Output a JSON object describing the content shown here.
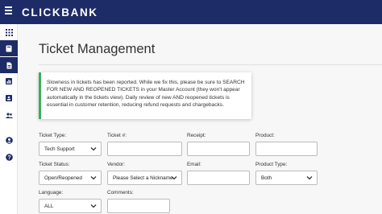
{
  "header": {
    "logo": "CLICKBANK",
    "menu_icon": "hamburger-menu-icon"
  },
  "sidebar": {
    "items": [
      {
        "icon": "grid-icon",
        "active": false
      },
      {
        "icon": "book-icon",
        "active": true
      },
      {
        "icon": "document-icon",
        "active": true
      },
      {
        "icon": "bar-chart-icon",
        "active": false
      },
      {
        "icon": "id-card-icon",
        "active": false
      },
      {
        "icon": "users-icon",
        "active": false
      },
      {
        "icon": "account-circle-icon",
        "active": false
      },
      {
        "icon": "help-icon",
        "active": false
      }
    ]
  },
  "page": {
    "title": "Ticket Management"
  },
  "alert": {
    "message": "Slowness in tickets has been reported. While we fix this, please be sure to SEARCH FOR NEW AND REOPENED TICKETS in your Master Account (they won't appear automatically in the tickets view). Daily review of new AND reopened tickets is essential in customer retention, reducing refund requests and chargebacks.",
    "accent_color": "#3cae5b"
  },
  "form": {
    "ticket_type": {
      "label": "Ticket Type:",
      "value": "Tech Support"
    },
    "ticket_number": {
      "label": "Ticket #:",
      "value": ""
    },
    "receipt": {
      "label": "Receipt:",
      "value": ""
    },
    "product": {
      "label": "Product:",
      "value": ""
    },
    "ticket_status": {
      "label": "Ticket Status:",
      "value": "Open/Reopened"
    },
    "vendor": {
      "label": "Vendor:",
      "value": "Please Select a Nickname"
    },
    "email": {
      "label": "Email:",
      "value": ""
    },
    "product_type": {
      "label": "Product Type:",
      "value": "Both"
    },
    "language": {
      "label": "Language:",
      "value": "ALL"
    },
    "comments": {
      "label": "Comments:",
      "value": ""
    }
  },
  "colors": {
    "brand": "#1d2b66",
    "background": "#f7f7f7"
  }
}
